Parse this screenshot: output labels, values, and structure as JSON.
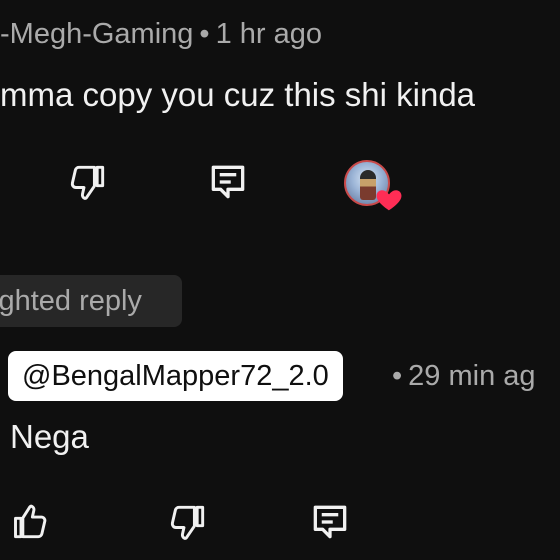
{
  "top_comment": {
    "author": "-Megh-Gaming",
    "separator": "•",
    "time": "1 hr ago",
    "text": "mma copy you cuz this shi kinda",
    "actions": {
      "dislike_icon": "thumbs-down-icon",
      "reply_icon": "comment-reply-icon",
      "creator_heart_icon": "heart-icon"
    }
  },
  "highlighted_label": "ighted reply",
  "reply": {
    "author": "@BengalMapper72_2.0",
    "separator": "•",
    "time": "29 min ag",
    "text": "Nega",
    "actions": {
      "like_icon": "thumbs-up-icon",
      "dislike_icon": "thumbs-down-icon",
      "reply_icon": "comment-reply-icon"
    }
  },
  "colors": {
    "background": "#0f0f0f",
    "text_primary": "#f1f1f1",
    "text_secondary": "#aaaaaa",
    "chip_background": "#272727",
    "author_highlight": "#ffffff",
    "heart": "#ff2d55"
  }
}
